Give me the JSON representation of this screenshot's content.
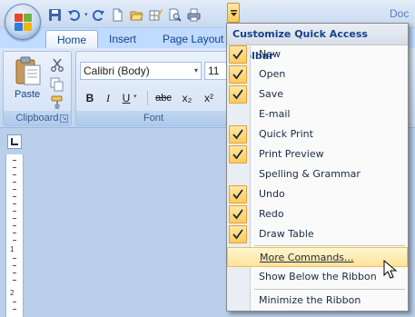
{
  "window": {
    "title_fragment": "Doc"
  },
  "quick_access": {
    "icons": [
      "save-icon",
      "undo-icon",
      "redo-icon",
      "new-icon",
      "open-icon",
      "draw-table-icon",
      "print-preview-icon",
      "quick-print-icon"
    ],
    "dropdown_icon": "customize-arrow-icon"
  },
  "tabs": [
    {
      "label": "Home",
      "active": true
    },
    {
      "label": "Insert",
      "active": false
    },
    {
      "label": "Page Layout",
      "active": false
    }
  ],
  "ribbon": {
    "clipboard": {
      "label": "Clipboard",
      "paste_label": "Paste"
    },
    "font": {
      "label": "Font",
      "font_name": "Calibri (Body)",
      "font_size": "11",
      "buttons": [
        "B",
        "I",
        "U",
        "abc",
        "x₂",
        "x²"
      ]
    }
  },
  "ruler": {
    "numbers": [
      "1",
      "2"
    ]
  },
  "menu": {
    "title": "Customize Quick Access Toolbar",
    "items": [
      {
        "label": "New",
        "checked": true
      },
      {
        "label": "Open",
        "checked": true
      },
      {
        "label": "Save",
        "checked": true
      },
      {
        "label": "E-mail",
        "checked": false
      },
      {
        "label": "Quick Print",
        "checked": true
      },
      {
        "label": "Print Preview",
        "checked": true
      },
      {
        "label": "Spelling & Grammar",
        "checked": false
      },
      {
        "label": "Undo",
        "checked": true
      },
      {
        "label": "Redo",
        "checked": true
      },
      {
        "label": "Draw Table",
        "checked": true
      }
    ],
    "more_commands": "More Commands...",
    "show_below": "Show Below the Ribbon",
    "minimize": "Minimize the Ribbon"
  },
  "colors": {
    "ribbon_blue": "#bfdbff",
    "highlight": "#ffe39a",
    "check_fill": "#ffcb5c",
    "text_blue": "#15428b"
  }
}
